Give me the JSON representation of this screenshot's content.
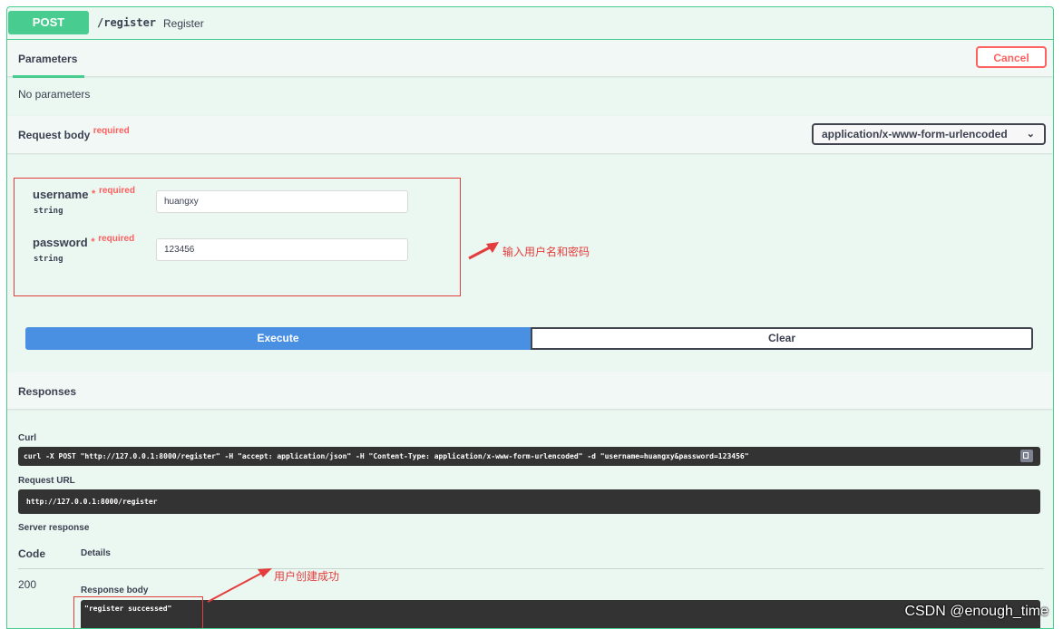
{
  "operation": {
    "method": "POST",
    "path": "/register",
    "summary": "Register"
  },
  "parameters": {
    "tab_label": "Parameters",
    "cancel_label": "Cancel",
    "empty_text": "No parameters"
  },
  "request_body": {
    "title": "Request body",
    "required_label": "required",
    "content_type": "application/x-www-form-urlencoded",
    "fields": [
      {
        "name": "username",
        "required_mark": "*",
        "required_label": "required",
        "type": "string",
        "value": "huangxy"
      },
      {
        "name": "password",
        "required_mark": "*",
        "required_label": "required",
        "type": "string",
        "value": "123456"
      }
    ],
    "annotation": "输入用户名和密码"
  },
  "actions": {
    "execute_label": "Execute",
    "clear_label": "Clear"
  },
  "responses": {
    "title": "Responses",
    "curl_label": "Curl",
    "curl_command": "curl -X POST \"http://127.0.0.1:8000/register\" -H  \"accept: application/json\" -H  \"Content-Type: application/x-www-form-urlencoded\" -d \"username=huangxy&password=123456\"",
    "request_url_label": "Request URL",
    "request_url": "http://127.0.0.1:8000/register",
    "server_response_label": "Server response",
    "code_header": "Code",
    "details_header": "Details",
    "code": "200",
    "response_body_label": "Response body",
    "response_body": "\"register successed\"",
    "annotation": "用户创建成功"
  },
  "watermark": "CSDN @enough_time",
  "colors": {
    "post_green": "#49cc90",
    "execute_blue": "#4990e2",
    "cancel_red": "#ff6060",
    "annotation_red": "#e43d3d"
  }
}
